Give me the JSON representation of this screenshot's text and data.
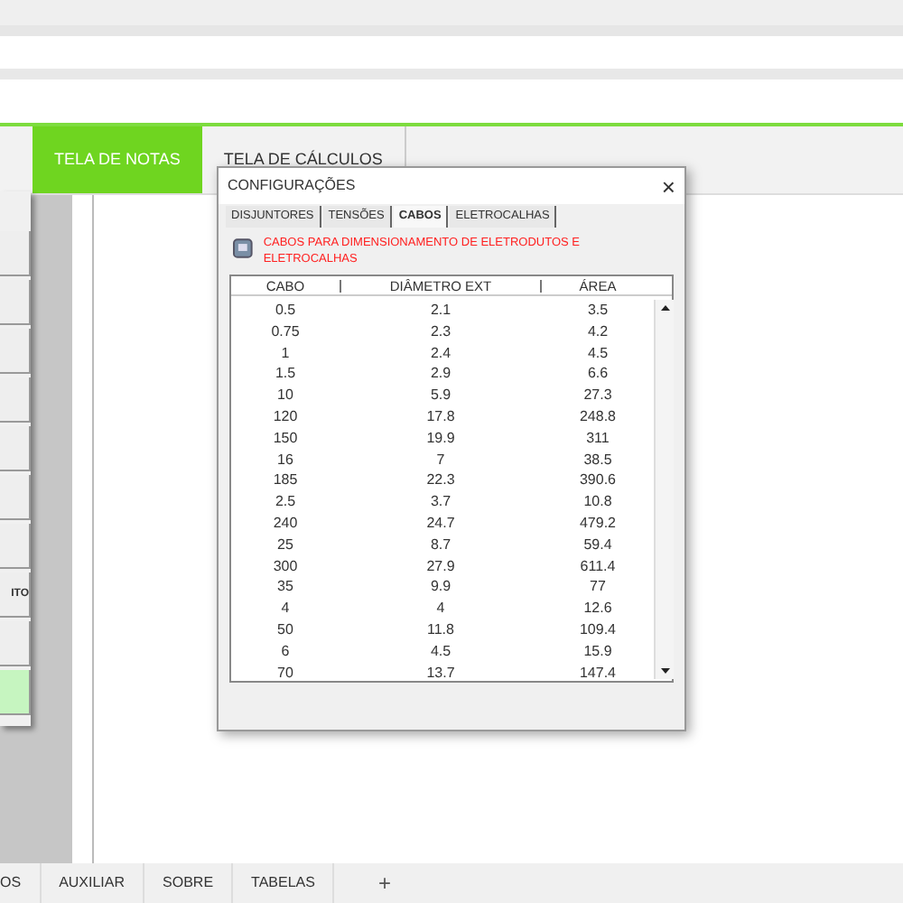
{
  "sheet_tabs_top": [
    {
      "label": "TELA DE NOTAS",
      "selected": true
    },
    {
      "label": "TELA DE CÁLCULOS",
      "selected": false
    }
  ],
  "left_panel": {
    "buttons": [
      {
        "kind": "plain"
      },
      {
        "kind": "plain"
      },
      {
        "kind": "plain"
      },
      {
        "kind": "plain"
      },
      {
        "kind": "plain"
      },
      {
        "kind": "plain"
      },
      {
        "kind": "plain"
      },
      {
        "label": "ITO",
        "kind": "plain"
      },
      {
        "kind": "plain"
      },
      {
        "kind": "green"
      }
    ]
  },
  "dialog": {
    "title": "CONFIGURAÇÕES",
    "close": "×",
    "tabs": [
      {
        "label": "DISJUNTORES",
        "selected": false
      },
      {
        "label": "TENSÕES",
        "selected": false
      },
      {
        "label": "CABOS",
        "selected": true
      },
      {
        "label": "ELETROCALHAS",
        "selected": false
      }
    ],
    "note": "CABOS PARA DIMENSIONAMENTO DE ELETRODUTOS E ELETROCALHAS",
    "table": {
      "columns": [
        "CABO",
        "DIÂMETRO EXT",
        "ÁREA"
      ],
      "rows": [
        [
          "0.5",
          "2.1",
          "3.5"
        ],
        [
          "0.75",
          "2.3",
          "4.2"
        ],
        [
          "1",
          "2.4",
          "4.5"
        ],
        [
          "1.5",
          "2.9",
          "6.6"
        ],
        [
          "10",
          "5.9",
          "27.3"
        ],
        [
          "120",
          "17.8",
          "248.8"
        ],
        [
          "150",
          "19.9",
          "311"
        ],
        [
          "16",
          "7",
          "38.5"
        ],
        [
          "185",
          "22.3",
          "390.6"
        ],
        [
          "2.5",
          "3.7",
          "10.8"
        ],
        [
          "240",
          "24.7",
          "479.2"
        ],
        [
          "25",
          "8.7",
          "59.4"
        ],
        [
          "300",
          "27.9",
          "611.4"
        ],
        [
          "35",
          "9.9",
          "77"
        ],
        [
          "4",
          "4",
          "12.6"
        ],
        [
          "50",
          "11.8",
          "109.4"
        ],
        [
          "6",
          "4.5",
          "15.9"
        ],
        [
          "70",
          "13.7",
          "147.4"
        ]
      ]
    }
  },
  "sheet_tabs_bottom": [
    {
      "label": "OS"
    },
    {
      "label": "AUXILIAR"
    },
    {
      "label": "SOBRE"
    },
    {
      "label": "TABELAS"
    }
  ],
  "add_sheet": "+"
}
